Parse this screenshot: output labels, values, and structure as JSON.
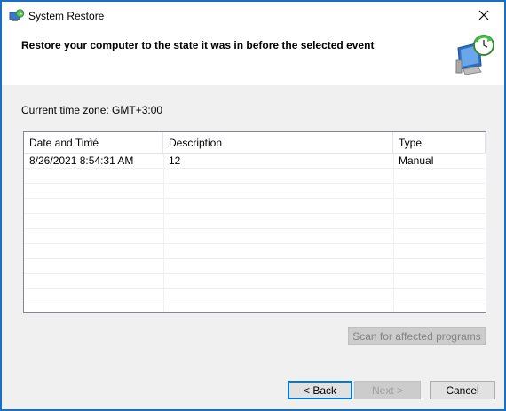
{
  "window": {
    "title": "System Restore",
    "title_icon": "system-restore-icon",
    "close_icon": "close-icon",
    "frame_color": "#1a6fc4"
  },
  "header": {
    "instruction": "Restore your computer to the state it was in before the selected event",
    "art": "computer-restore-clock-icon"
  },
  "timezone": {
    "label": "Current time zone: GMT+3:00"
  },
  "restore_points": {
    "columns": [
      "Date and Time",
      "Description",
      "Type"
    ],
    "sorted_column": "Date and Time",
    "rows": [
      {
        "date_time": "8/26/2021 8:54:31 AM",
        "description": "12",
        "type": "Manual"
      }
    ]
  },
  "buttons": {
    "scan": "Scan for affected programs",
    "back": "< Back",
    "next": "Next >",
    "cancel": "Cancel"
  }
}
